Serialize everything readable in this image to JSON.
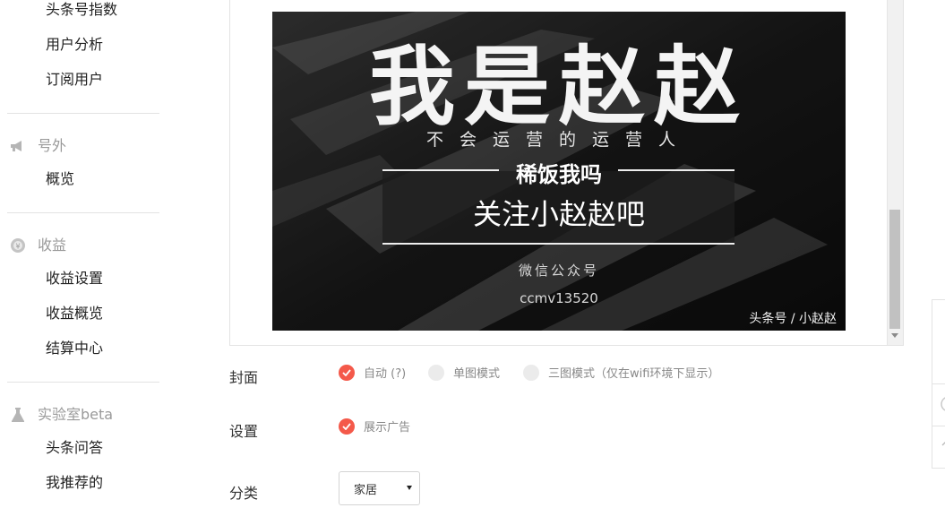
{
  "sidebar": {
    "group_top_items": [
      "头条号指数",
      "用户分析",
      "订阅用户"
    ],
    "sections": [
      {
        "title": "号外",
        "icon": "megaphone-icon",
        "items": [
          "概览"
        ]
      },
      {
        "title": "收益",
        "icon": "coin-icon",
        "items": [
          "收益设置",
          "收益概览",
          "结算中心"
        ]
      },
      {
        "title": "实验室beta",
        "icon": "flask-icon",
        "items": [
          "头条问答",
          "我推荐的"
        ]
      }
    ]
  },
  "poster": {
    "title": "我是赵赵",
    "tagline": "不会运营的运营人",
    "subheading": "稀饭我吗",
    "main_text": "关注小赵赵吧",
    "wechat_label": "微信公众号",
    "wechat_id": "ccmv13520",
    "watermark": "头条号 / 小赵赵"
  },
  "form": {
    "cover": {
      "label": "封面",
      "options": [
        {
          "label": "自动 (?)",
          "selected": true
        },
        {
          "label": "单图模式",
          "selected": false
        },
        {
          "label": "三图模式（仅在wifi环境下显示）",
          "selected": false
        }
      ]
    },
    "settings": {
      "label": "设置",
      "options": [
        {
          "label": "展示广告",
          "selected": true
        }
      ]
    },
    "category": {
      "label": "分类",
      "value": "家居"
    }
  },
  "colors": {
    "accent": "#f4594a",
    "muted": "#9a9a9a"
  }
}
